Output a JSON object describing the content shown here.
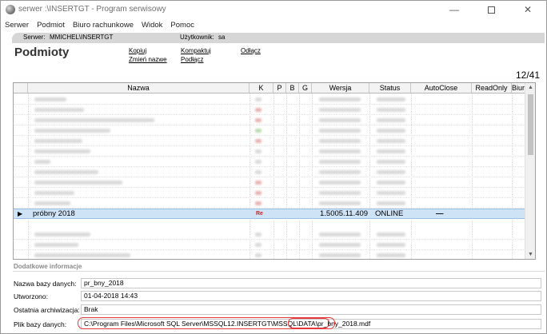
{
  "window": {
    "title": "serwer :\\INSERTGT - Program serwisowy",
    "minimize_glyph": "—",
    "close_glyph": "✕"
  },
  "menu": [
    "Serwer",
    "Podmiot",
    "Biuro rachunkowe",
    "Widok",
    "Pomoc"
  ],
  "tab": {
    "server_label": "Serwer:",
    "server_value": "MMICHEL\\INSERTGT",
    "user_label": "Użytkownik:",
    "user_value": "sa"
  },
  "page": {
    "title": "Podmioty",
    "counter": "12/41",
    "links": {
      "copy": "Kopiuj",
      "rename": "Zmień nazwe",
      "compact": "Kompaktuj",
      "attach": "Podłącz",
      "detach": "Odłącz"
    }
  },
  "grid": {
    "columns": [
      "",
      "Nazwa",
      "K",
      "P",
      "B",
      "G",
      "Wersja",
      "Status",
      "AutoClose",
      "ReadOnly",
      "Biuro"
    ],
    "selected_row": {
      "marker": "▶",
      "name": "próbny 2018",
      "k": "Re",
      "version": "1.5005.11.409",
      "status": "ONLINE",
      "autoclose": "—"
    }
  },
  "details": {
    "section_title": "Dodatkowe informacje",
    "db_name_label": "Nazwa bazy danych:",
    "db_name": "pr_bny_2018",
    "created_label": "Utworzono:",
    "created": "01-04-2018 14:43",
    "archived_label": "Ostatnia archiwizacja:",
    "archived": "Brak",
    "file_label": "Plik bazy danych:",
    "file_path": "C:\\Program Files\\Microsoft SQL Server\\MSSQL12.INSERTGT\\MSSQL\\DATA\\pr_bny_2018.mdf"
  },
  "colors": {
    "selection": "#cfe3f7",
    "highlight": "#e63a3a"
  }
}
